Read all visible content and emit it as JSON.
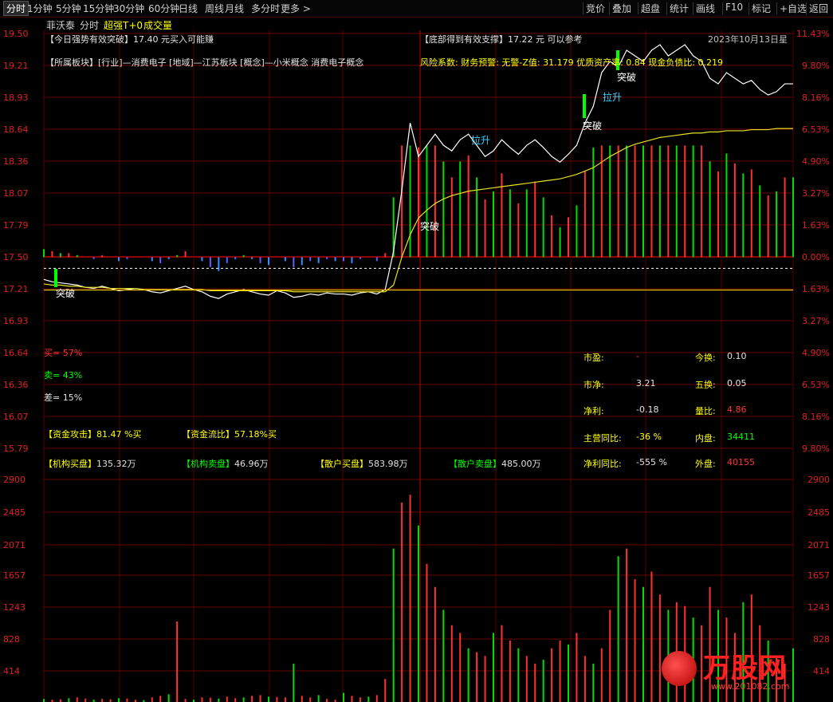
{
  "toolbar": {
    "tabs": [
      "分时",
      "1分钟",
      "5分钟",
      "15分钟",
      "30分钟",
      "60分钟",
      "日线",
      "周线",
      "月线",
      "多分时",
      "更多 >"
    ],
    "right_buttons": [
      "竞价",
      "叠加",
      "超盘",
      "统计",
      "画线",
      "F10",
      "标记",
      "+自选",
      "返回"
    ]
  },
  "header": {
    "stock_name": "菲沃泰",
    "period": "分时",
    "indicator": "超强T+0",
    "volume_label": "成交量"
  },
  "overlays": {
    "strong_break": "【今日强势有效突破】17.40 元买入可能赚",
    "bottom_support": "【底部得到有效支撑】17.22 元 可以参考",
    "date": "2023年10月13日星",
    "sector": "【所属板块】[行业]—消费电子 [地域]—江苏板块 [概念]—小米概念 消费电子概念",
    "risk": "风险系数: 财务预警: 无警-Z值: 31.179 优质资产率: 0.84 现金负债比: 0.219",
    "buy_pct": "买= 57%",
    "sell_pct": "卖= 43%",
    "diff_pct": "差= 15%",
    "fund_attack_label": "【资金攻击】",
    "fund_attack_val": "81.47 %买",
    "fund_flow_label": "【资金流比】",
    "fund_flow_val": "57.18%买",
    "inst_buy_label": "【机构买盘】",
    "inst_buy_val": "135.32万",
    "inst_sell_label": "【机构卖盘】",
    "inst_sell_val": "46.96万",
    "retail_buy_label": "【散户买盘】",
    "retail_buy_val": "583.98万",
    "retail_sell_label": "【散户卖盘】",
    "retail_sell_val": "485.00万"
  },
  "stats": {
    "pe_label": "市盈:",
    "pe_val": "-",
    "turn_label": "今换:",
    "turn_val": "0.10",
    "pb_label": "市净:",
    "pb_val": "3.21",
    "turn5_label": "五换:",
    "turn5_val": "0.05",
    "np_label": "净利:",
    "np_val": "-0.18",
    "vr_label": "量比:",
    "vr_val": "4.86",
    "rev_yoy_label": "主营同比:",
    "rev_yoy_val": "-36 %",
    "inner_label": "内盘:",
    "inner_val": "34411",
    "np_yoy_label": "净利同比:",
    "np_yoy_val": "-555 %",
    "outer_label": "外盘:",
    "outer_val": "40155"
  },
  "annotations": {
    "tupo": "突破",
    "lasheng": "拉升"
  },
  "watermark": "万股网",
  "watermark_url": "www.201082.com",
  "chart_data": {
    "type": "line",
    "title": "",
    "price_axis": {
      "left_labels": [
        "19.50",
        "19.21",
        "18.93",
        "18.64",
        "18.36",
        "18.07",
        "17.79",
        "17.50",
        "17.21",
        "16.93",
        "16.64",
        "16.36",
        "16.07",
        "15.79"
      ],
      "right_labels": [
        "11.43%",
        "9.80%",
        "8.16%",
        "6.53%",
        "4.90%",
        "3.27%",
        "1.63%",
        "0.00%",
        "1.63%",
        "3.27%",
        "4.90%",
        "6.53%",
        "8.16%",
        "9.80%"
      ],
      "prev_close": 17.5,
      "ylim": [
        15.79,
        19.5
      ]
    },
    "volume_axis": {
      "labels": [
        "2900",
        "2485",
        "2071",
        "1657",
        "1243",
        "828",
        "414"
      ],
      "ylim": [
        0,
        2900
      ]
    },
    "series": [
      {
        "values": [
          17.3,
          17.28,
          17.27,
          17.26,
          17.25,
          17.23,
          17.22,
          17.24,
          17.22,
          17.2,
          17.21,
          17.22,
          17.21,
          17.19,
          17.18,
          17.2,
          17.22,
          17.24,
          17.21,
          17.19,
          17.15,
          17.13,
          17.17,
          17.19,
          17.21,
          17.19,
          17.17,
          17.16,
          17.2,
          17.18,
          17.14,
          17.15,
          17.17,
          17.16,
          17.18,
          17.17,
          17.17,
          17.16,
          17.18,
          17.19,
          17.17,
          17.21,
          17.55,
          18.1,
          18.7,
          18.4,
          18.5,
          18.6,
          18.5,
          18.45,
          18.55,
          18.6,
          18.5,
          18.4,
          18.45,
          18.55,
          18.48,
          18.42,
          18.5,
          18.55,
          18.48,
          18.4,
          18.35,
          18.42,
          18.5,
          18.7,
          18.85,
          19.15,
          19.25,
          19.2,
          19.35,
          19.3,
          19.25,
          19.35,
          19.4,
          19.3,
          19.35,
          19.4,
          19.3,
          19.25,
          19.1,
          19.05,
          19.15,
          19.1,
          19.05,
          19.08,
          19.0,
          18.95,
          18.98,
          19.05,
          19.05
        ]
      },
      {
        "values": [
          17.26,
          17.25,
          17.25,
          17.24,
          17.24,
          17.23,
          17.23,
          17.23,
          17.22,
          17.22,
          17.22,
          17.22,
          17.21,
          17.21,
          17.21,
          17.21,
          17.21,
          17.21,
          17.21,
          17.21,
          17.2,
          17.2,
          17.2,
          17.2,
          17.2,
          17.2,
          17.2,
          17.2,
          17.2,
          17.2,
          17.19,
          17.19,
          17.19,
          17.19,
          17.19,
          17.19,
          17.19,
          17.19,
          17.19,
          17.19,
          17.19,
          17.19,
          17.25,
          17.5,
          17.7,
          17.85,
          17.92,
          17.98,
          18.02,
          18.05,
          18.07,
          18.09,
          18.1,
          18.11,
          18.12,
          18.13,
          18.14,
          18.15,
          18.16,
          18.17,
          18.18,
          18.19,
          18.2,
          18.22,
          18.24,
          18.27,
          18.3,
          18.35,
          18.4,
          18.44,
          18.48,
          18.51,
          18.53,
          18.55,
          18.57,
          18.58,
          18.59,
          18.6,
          18.61,
          18.61,
          18.62,
          18.62,
          18.63,
          18.63,
          18.63,
          18.64,
          18.64,
          18.64,
          18.65,
          18.65,
          18.65
        ]
      }
    ],
    "volume": [
      40,
      30,
      35,
      50,
      60,
      45,
      30,
      40,
      35,
      50,
      45,
      30,
      25,
      60,
      80,
      100,
      1050,
      40,
      30,
      60,
      55,
      45,
      70,
      50,
      60,
      80,
      90,
      70,
      65,
      60,
      500,
      80,
      60,
      90,
      40,
      30,
      120,
      80,
      60,
      70,
      90,
      300,
      2000,
      2600,
      2700,
      2300,
      1800,
      1500,
      1200,
      1000,
      900,
      700,
      650,
      600,
      900,
      1000,
      800,
      700,
      600,
      500,
      550,
      700,
      800,
      750,
      900,
      600,
      500,
      700,
      1200,
      1900,
      2000,
      1600,
      1500,
      1700,
      1400,
      1200,
      1300,
      1250,
      1100,
      1000,
      1500,
      1200,
      1100,
      900,
      1300,
      1400,
      1000,
      800,
      600,
      500,
      700
    ]
  }
}
